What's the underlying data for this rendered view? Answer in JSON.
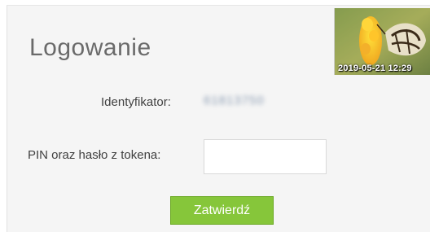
{
  "login": {
    "title": "Logowanie",
    "identifier_label": "Identyfikator:",
    "identifier_value": "61813750",
    "pin_label": "PIN oraz hasło z tokena:",
    "pin_value": "",
    "submit_label": "Zatwierdź"
  },
  "security_image": {
    "icon": "butterfly-flower-photo",
    "timestamp": "2019-05-21 12:29"
  },
  "colors": {
    "submit_bg": "#86c63a",
    "panel_bg": "#f5f5f5",
    "title_text": "#6a6a6a"
  }
}
